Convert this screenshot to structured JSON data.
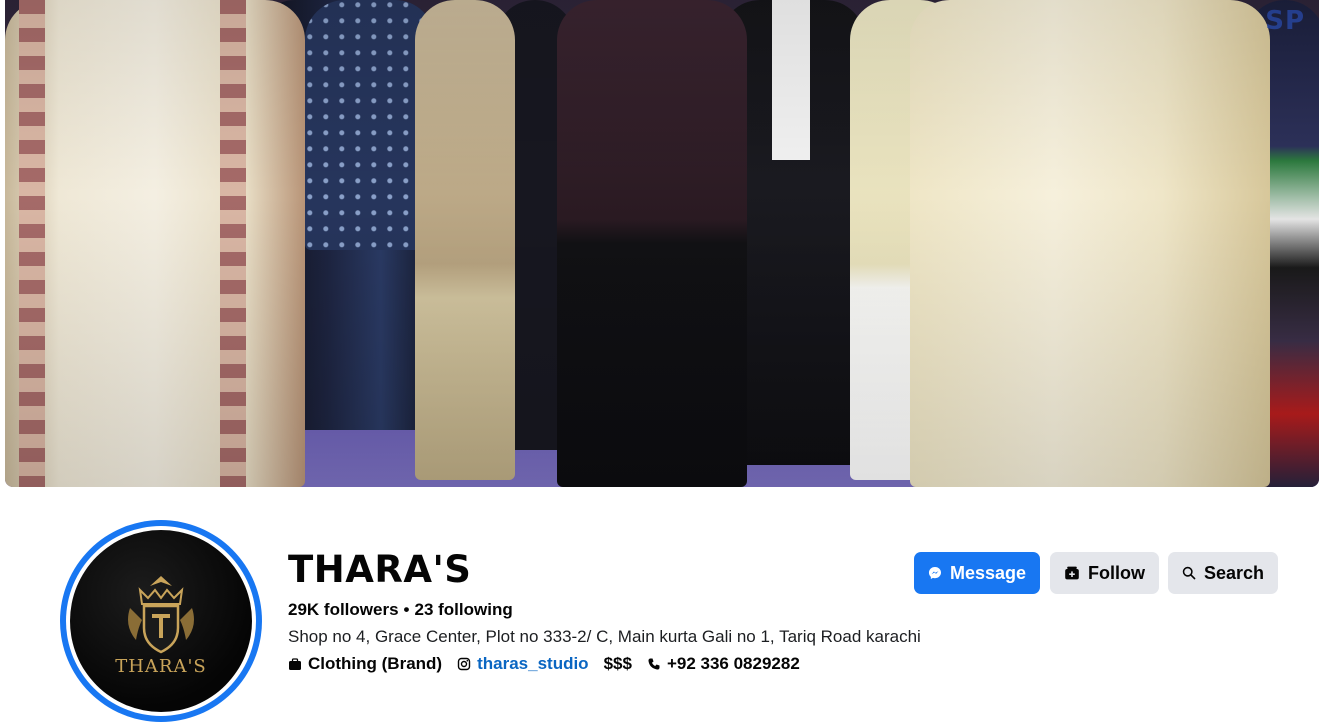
{
  "cover": {
    "corner_text": "SP"
  },
  "profile": {
    "logo_text": "THARA'S",
    "name": "THARA'S",
    "followers": "29K followers",
    "separator": "•",
    "following": "23 following",
    "address": "Shop no 4, Grace Center, Plot no 333-2/ C, Main kurta Gali no 1, Tariq Road karachi",
    "category": "Clothing (Brand)",
    "instagram": "tharas_studio",
    "price_range": "$$$",
    "phone": "+92 336 0829282"
  },
  "actions": {
    "message": "Message",
    "follow": "Follow",
    "search": "Search"
  },
  "icons": {
    "message": "messenger-icon",
    "follow": "follow-icon",
    "search": "search-icon",
    "category": "briefcase-icon",
    "instagram": "instagram-icon",
    "phone": "phone-icon"
  },
  "colors": {
    "accent": "#1877f2",
    "secondary_button": "#e4e6eb",
    "link": "#0a66c2",
    "logo_gold": "#c9a45a"
  }
}
